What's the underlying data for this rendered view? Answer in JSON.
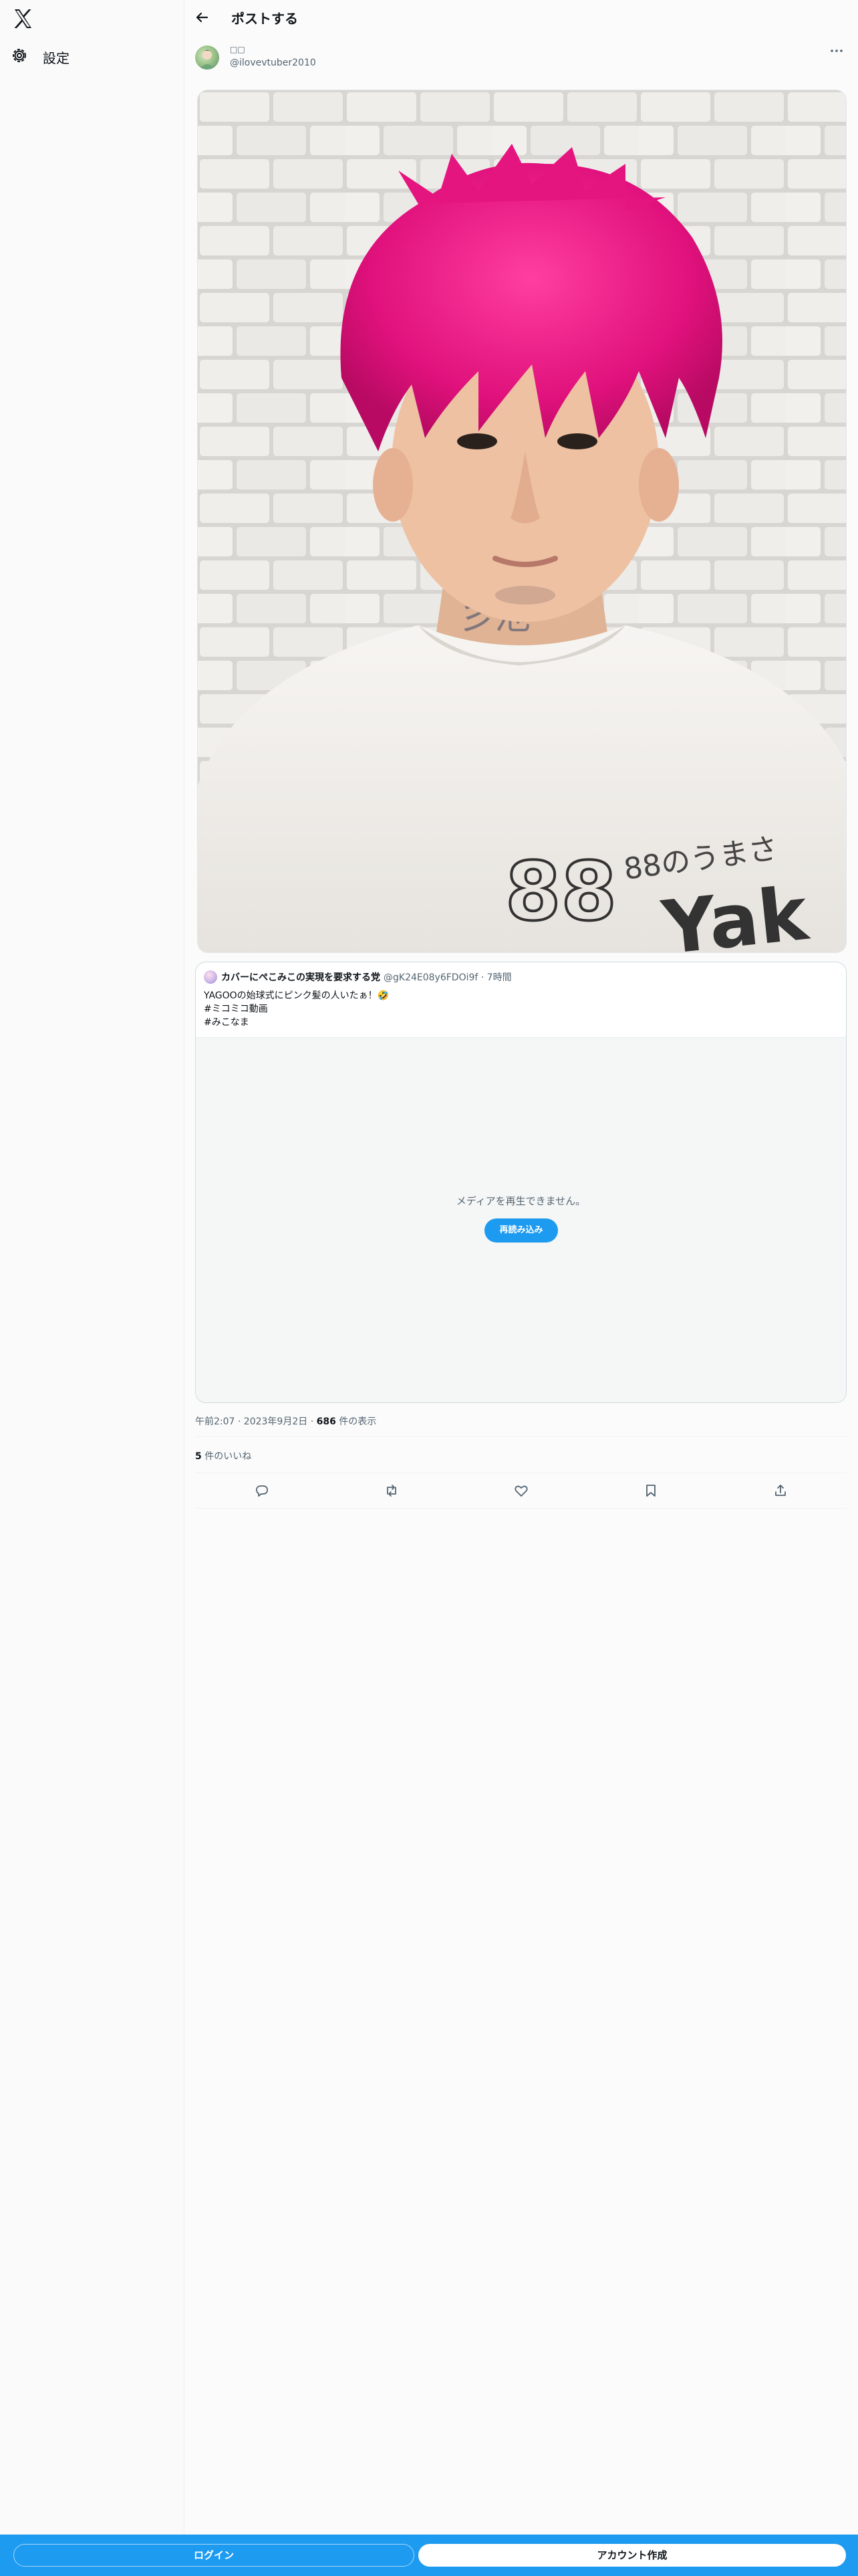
{
  "sidebar": {
    "logo_icon": "x-logo-icon",
    "settings_label": "設定"
  },
  "header": {
    "title": "ポストする"
  },
  "post": {
    "display_name": "□□",
    "handle": "@ilovevtuber2010",
    "timestamp": "午前2:07 · 2023年9月2日",
    "views_count": "686",
    "views_label": "件の表示",
    "likes_count": "5",
    "likes_label": "件のいいね",
    "photo_shirt_text": "88のうまさ"
  },
  "quoted_post": {
    "name": "カバーにぺこみこの実現を要求する党",
    "handle": "@gK24E08y6FDOi9f · 7時間",
    "line1": "YAGOOの始球式にピンク髪の人いたぁ！🤣",
    "line2": "#ミコミコ動画",
    "line3": "#みこなま",
    "media_message": "メディアを再生できません。",
    "reload_label": "再読み込み"
  },
  "actions": [
    "reply-icon",
    "repost-icon",
    "like-icon",
    "bookmark-icon",
    "share-icon"
  ],
  "bottom_bar": {
    "login_label": "ログイン",
    "signup_label": "アカウント作成"
  },
  "colors": {
    "accent": "#1d9bf0",
    "text": "#0f1419",
    "secondary_text": "#536471"
  }
}
